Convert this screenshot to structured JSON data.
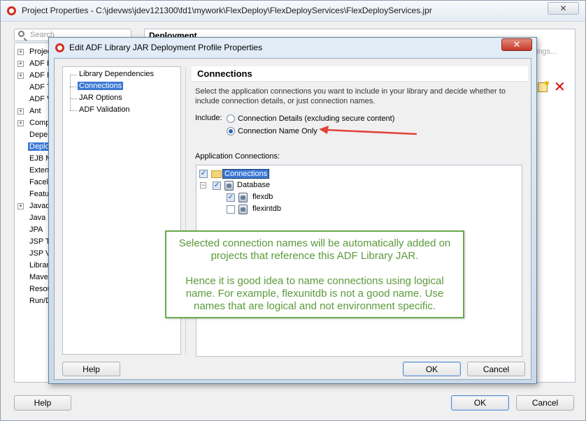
{
  "outer_window": {
    "title": "Project Properties - C:\\jdevws\\jdev121300\\fd1\\mywork\\FlexDeploy\\FlexDeployServices\\FlexDeployServices.jpr",
    "close_label": "✕",
    "search_placeholder": "Search",
    "tree_items": [
      {
        "label": "Project",
        "expandable": true
      },
      {
        "label": "ADF B",
        "expandable": true
      },
      {
        "label": "ADF M",
        "expandable": true
      },
      {
        "label": "ADF T",
        "expandable": false
      },
      {
        "label": "ADF V",
        "expandable": false
      },
      {
        "label": "Ant",
        "expandable": true
      },
      {
        "label": "Comp",
        "expandable": true
      },
      {
        "label": "Deper",
        "expandable": false
      },
      {
        "label": "Deplo",
        "expandable": false,
        "selected": true
      },
      {
        "label": "EJB M",
        "expandable": false
      },
      {
        "label": "Exten",
        "expandable": false
      },
      {
        "label": "Facele",
        "expandable": false
      },
      {
        "label": "Featu",
        "expandable": false
      },
      {
        "label": "Javad",
        "expandable": true
      },
      {
        "label": "Java",
        "expandable": false
      },
      {
        "label": "JPA",
        "expandable": false
      },
      {
        "label": "JSP Ta",
        "expandable": false
      },
      {
        "label": "JSP Vi",
        "expandable": false
      },
      {
        "label": "Librar",
        "expandable": false
      },
      {
        "label": "Maven",
        "expandable": false
      },
      {
        "label": "Resou",
        "expandable": false
      },
      {
        "label": "Run/D",
        "expandable": false
      }
    ],
    "section_title": "Deployment",
    "settings_label": "ings...",
    "help_label": "Help",
    "ok_label": "OK",
    "cancel_label": "Cancel"
  },
  "dialog": {
    "title": "Edit ADF Library JAR Deployment Profile Properties",
    "close_label": "✕",
    "nav_items": [
      {
        "label": "Library Dependencies"
      },
      {
        "label": "Connections",
        "selected": true
      },
      {
        "label": "JAR Options"
      },
      {
        "label": "ADF Validation"
      }
    ],
    "connections": {
      "title": "Connections",
      "description": "Select the application connections you want to include in your library and decide whether to include connection details, or just connection names.",
      "include_label": "Include:",
      "options": [
        {
          "label": "Connection Details (excluding secure content)",
          "checked": false
        },
        {
          "label": "Connection Name Only",
          "checked": true
        }
      ],
      "app_connections_label": "Application Connections:",
      "tree": {
        "root": {
          "label": "Connections",
          "checked": true
        },
        "database": {
          "label": "Database",
          "checked": true
        },
        "items": [
          {
            "label": "flexdb",
            "checked": true
          },
          {
            "label": "flexintdb",
            "checked": false
          }
        ]
      }
    },
    "help_label": "Help",
    "ok_label": "OK",
    "cancel_label": "Cancel"
  },
  "callout": {
    "line1": "Selected connection names will be automatically added on projects that reference this ADF Library JAR.",
    "line2": "Hence it is good idea to name connections using logical name. For example, flexunitdb is not a good name. Use names that are logical and not environment specific.",
    "color": "#6aa84f"
  },
  "arrow_color": "#e0433a"
}
